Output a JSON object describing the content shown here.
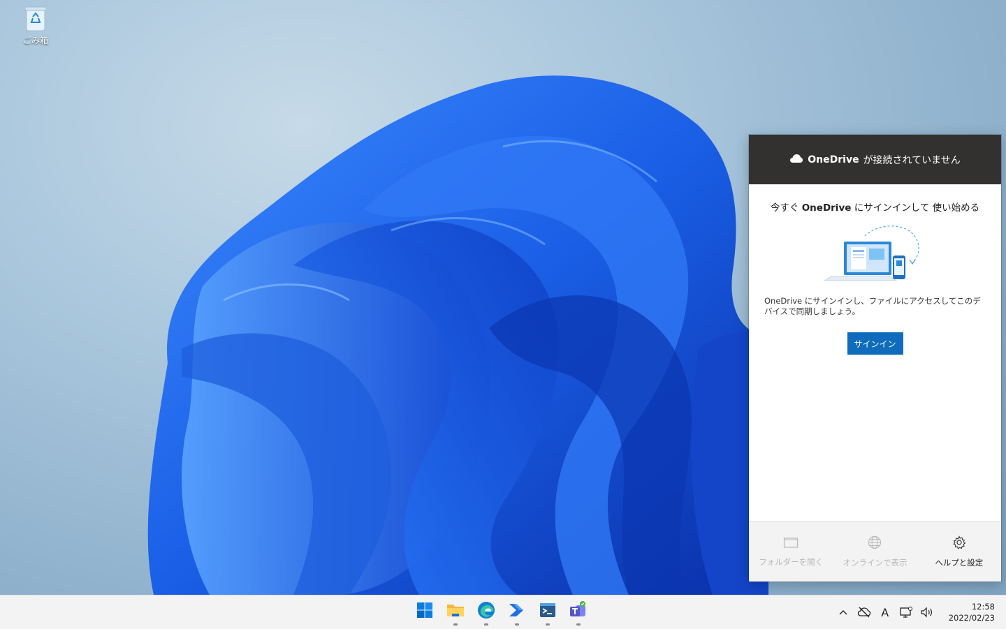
{
  "desktop": {
    "recycle_bin_label": "ごみ箱"
  },
  "onedrive": {
    "header_brand": "OneDrive",
    "header_text": "が接続されていません",
    "title_pre": "今すぐ",
    "title_brand": "OneDrive",
    "title_post": "にサインインして 使い始める",
    "description": "OneDrive にサインインし、ファイルにアクセスしてこのデバイスで同期しましょう。",
    "signin_label": "サインイン",
    "footer": {
      "open_folder": "フォルダーを開く",
      "view_online": "オンラインで表示",
      "help_settings": "ヘルプと設定"
    }
  },
  "taskbar": {
    "apps": [
      "start-icon",
      "file-explorer-icon",
      "edge-icon",
      "power-automate-icon",
      "powershell-icon",
      "teams-icon"
    ],
    "tray": {
      "ime": "A",
      "time": "12:58",
      "date": "2022/02/23"
    }
  },
  "colors": {
    "accent": "#0f6cbd",
    "flyout_header": "#323130"
  }
}
